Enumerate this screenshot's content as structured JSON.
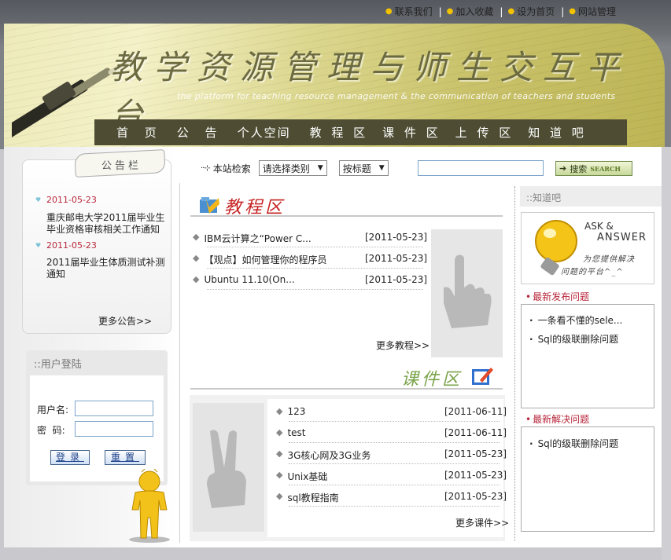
{
  "topbar": {
    "links": [
      "联系我们",
      "加入收藏",
      "设为首页",
      "网站管理"
    ]
  },
  "header": {
    "title": "教学资源管理与师生交互平台",
    "subtitle": "the platform for teaching resource management & the communication of teachers and students"
  },
  "nav": {
    "items": [
      "首 页",
      "公 告",
      "个人空间",
      "教 程 区",
      "课 件 区",
      "上 传 区",
      "知 道 吧"
    ]
  },
  "notice": {
    "title": "公告栏",
    "items": [
      {
        "date": "2011-05-23",
        "text": "重庆邮电大学2011届毕业生毕业资格审核相关工作通知"
      },
      {
        "date": "2011-05-23",
        "text": "2011届毕业生体质测试补测通知"
      }
    ],
    "more": "更多公告>>"
  },
  "login": {
    "title": "::用户登陆",
    "username_label": "用户名:",
    "password_label": "密  码:",
    "login_button": "登录",
    "reset_button": "重置"
  },
  "search": {
    "label": "本站检索",
    "category": "请选择类别",
    "field": "按标题",
    "button": "搜索",
    "button_en": "SEARCH"
  },
  "tutorials": {
    "heading": "教程区",
    "items": [
      {
        "title": "IBM云计算之“Power C...",
        "date": "[2011-05-23]"
      },
      {
        "title": "【观点】如何管理你的程序员",
        "date": "[2011-05-23]"
      },
      {
        "title": "Ubuntu 11.10(On...",
        "date": "[2011-05-23]"
      }
    ],
    "more": "更多教程>>"
  },
  "courseware": {
    "heading": "课件区",
    "items": [
      {
        "title": "123",
        "date": "[2011-06-11]"
      },
      {
        "title": "test",
        "date": "[2011-06-11]"
      },
      {
        "title": "3G核心网及3G业务",
        "date": "[2011-05-23]"
      },
      {
        "title": "Unix基础",
        "date": "[2011-05-23]"
      },
      {
        "title": "sql教程指南",
        "date": "[2011-05-23]"
      }
    ],
    "more": "更多课件>>"
  },
  "zhidao": {
    "title": "::知道吧",
    "ask_en_1": "ASK &",
    "ask_en_2": "ANSWER",
    "slogan_1": "为您提供解决",
    "slogan_2": "问题的平台^_^",
    "latest_label": "最新发布问题",
    "latest": [
      "一条看不懂的sele...",
      "Sql的级联删除问题"
    ],
    "solved_label": "最新解决问题",
    "solved": [
      "Sql的级联删除问题"
    ]
  },
  "colors": {
    "nav_bg": "#4e4d33",
    "accent_red": "#c62222",
    "date_red": "#b8263a",
    "header_dark": "#55595f"
  }
}
